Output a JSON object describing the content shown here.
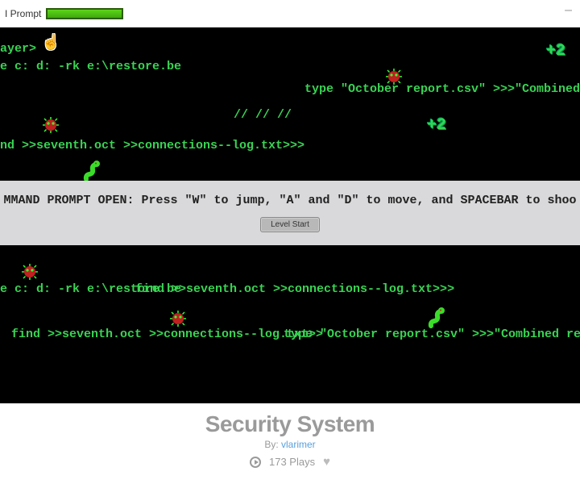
{
  "window": {
    "title": "I Prompt",
    "minimize": "–"
  },
  "hud": {
    "health_pct": 100
  },
  "terminal": {
    "lines": [
      "ayer>",
      "e c: d: -rk e:\\restore.be",
      "nd >>seventh.oct >>connections--log.txt>>>",
      "type \"October report.csv\" >>>\"Combined repo",
      "//   //   //",
      "e c: d: -rk e:\\restore.be",
      "find >>seventh.oct >>connections--log.txt>>>",
      "find >>seventh.oct >>connections--log.txt>>",
      "type \"October report.csv\" >>>\"Combined report.c"
    ],
    "popups": [
      "+2",
      "+2"
    ]
  },
  "overlay": {
    "instruction": "MMAND PROMPT OPEN: Press \"W\" to jump, \"A\" and \"D\" to move, and SPACEBAR to shoo",
    "button": "Level Start"
  },
  "meta": {
    "title": "Security System",
    "by_prefix": "By:",
    "author": "vlarimer",
    "plays": "173 Plays"
  }
}
